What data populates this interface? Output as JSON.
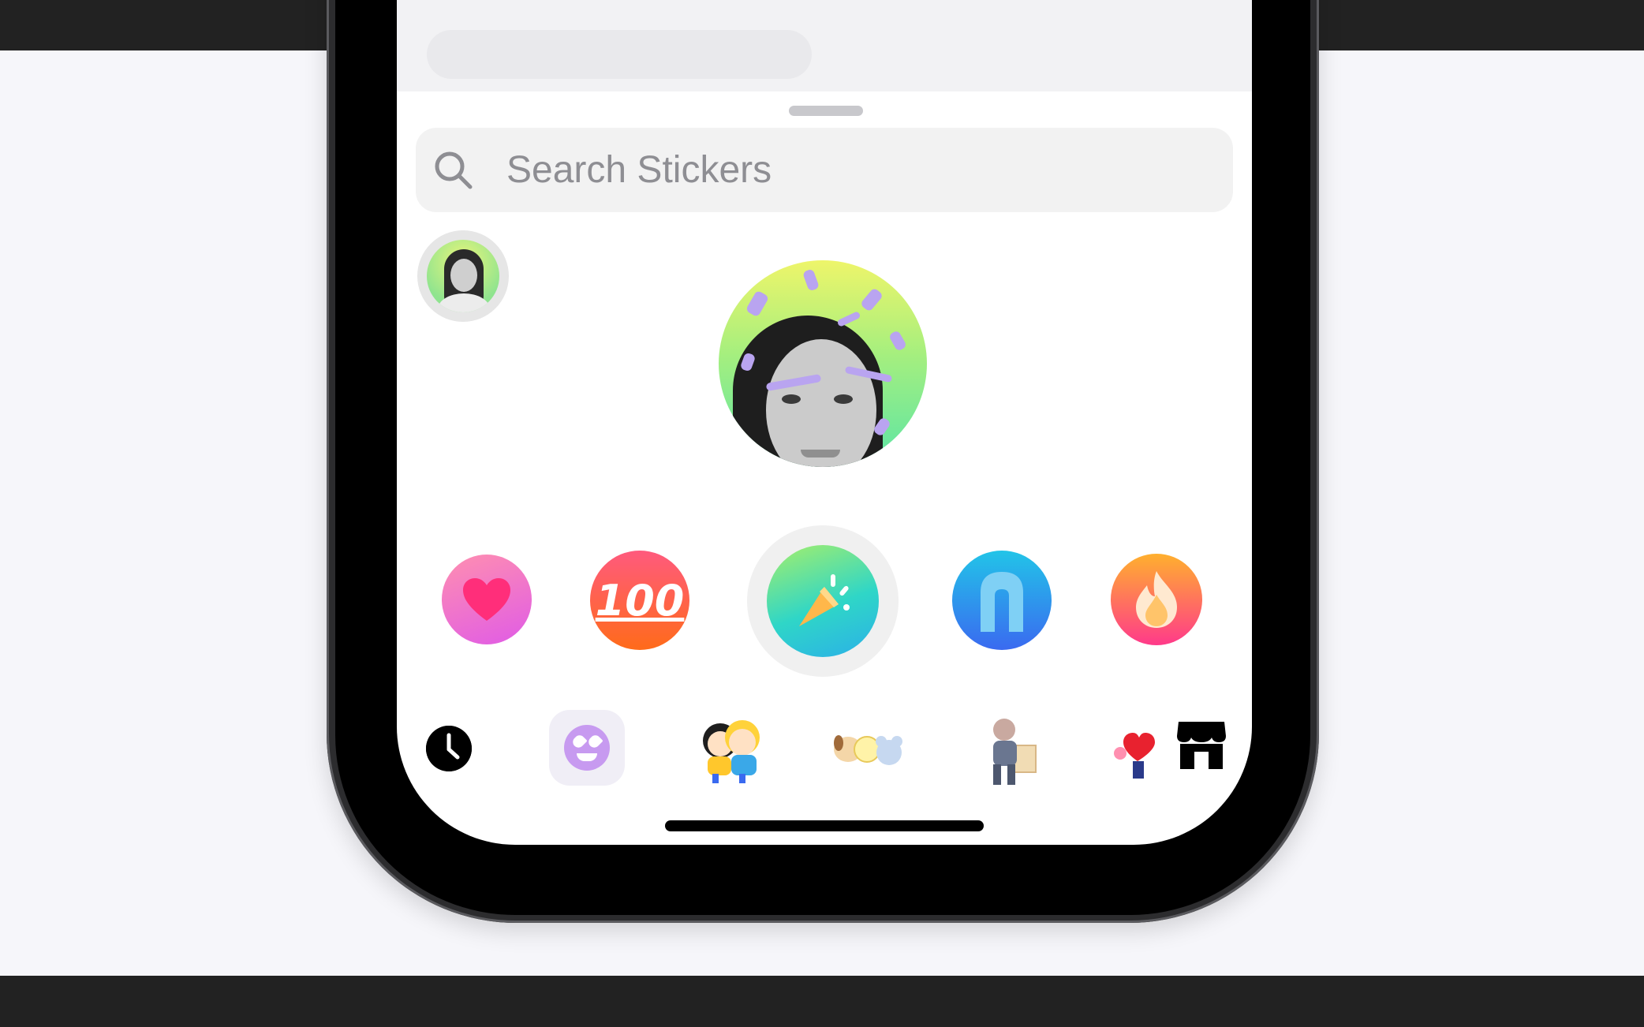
{
  "search": {
    "placeholder": "Search Stickers"
  },
  "reactions": [
    "heart",
    "hundred",
    "party",
    "waterfall",
    "fire"
  ],
  "hundred_label": "100",
  "selected_reaction": "party",
  "tray": [
    "recent",
    "emoji-pack",
    "kids-pack",
    "bt21-pack",
    "office-guy-pack",
    "heart-pack",
    "sticker-store"
  ],
  "colors": {
    "search_bg": "#f2f2f2",
    "placeholder": "#8e8e93",
    "accent_purple": "#c79af0"
  }
}
